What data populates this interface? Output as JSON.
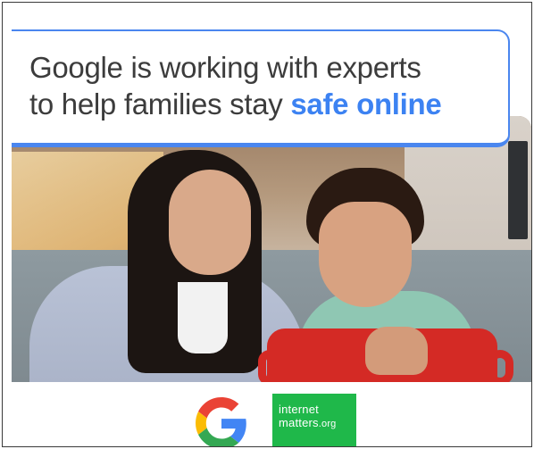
{
  "headline": {
    "line1": "Google is working with experts",
    "line2_prefix": "to help families stay ",
    "line2_accent": "safe online"
  },
  "photo": {
    "alt": "mother and son using a tablet"
  },
  "logos": {
    "google": "google-g-logo",
    "partner_line1": "internet",
    "partner_line2": "matters",
    "partner_line2_suffix": ".org"
  },
  "colors": {
    "accent_blue": "#3c82f2",
    "border_blue": "#4a86ef",
    "partner_green": "#1fb84a",
    "text": "#3c3c3c"
  }
}
